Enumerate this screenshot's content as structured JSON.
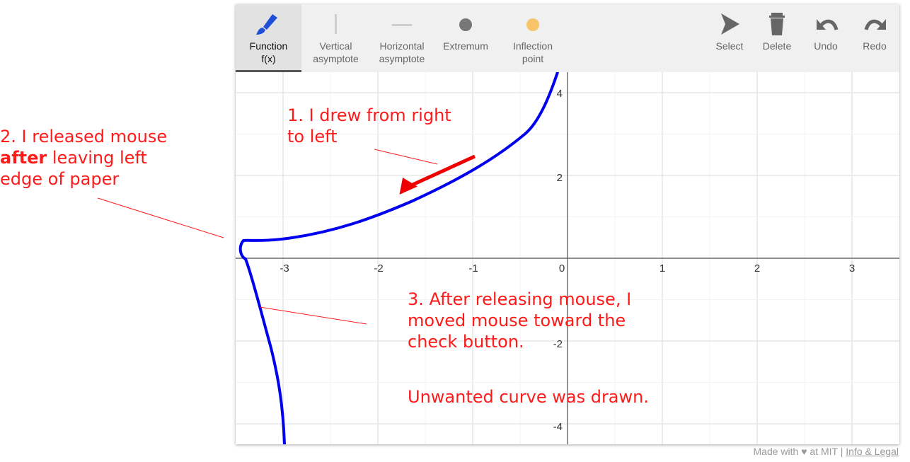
{
  "toolbar": {
    "tools": [
      {
        "label": "Function",
        "sublabel": "f(x)",
        "icon": "paintbrush-icon",
        "active": true
      },
      {
        "label": "Vertical",
        "sublabel": "asymptote",
        "icon": "vertical-line-icon"
      },
      {
        "label": "Horizontal",
        "sublabel": "asymptote",
        "icon": "horizontal-line-icon"
      },
      {
        "label": "Extremum",
        "sublabel": "",
        "icon": "dot-icon"
      },
      {
        "label": "Inflection",
        "sublabel": "point",
        "icon": "orange-dot-icon"
      },
      {
        "label": "Select",
        "sublabel": "",
        "icon": "cursor-arrow-icon"
      },
      {
        "label": "Delete",
        "sublabel": "",
        "icon": "trash-icon"
      },
      {
        "label": "Undo",
        "sublabel": "",
        "icon": "undo-icon"
      },
      {
        "label": "Redo",
        "sublabel": "",
        "icon": "redo-icon"
      }
    ]
  },
  "graph": {
    "x_ticks": [
      "-3",
      "-2",
      "-1",
      "0",
      "1",
      "2",
      "3"
    ],
    "y_ticks": [
      "4",
      "2",
      "-2",
      "-4"
    ],
    "curve_color": "#0000ee",
    "arrow_color": "#ff1a1a"
  },
  "annotations": {
    "note1": [
      "1. I drew from right",
      "to left"
    ],
    "note2_line1": "2. I released mouse",
    "note2_bold": "after",
    "note2_rest": " leaving left",
    "note2_line3": "edge of paper",
    "note3": [
      "3. After releasing mouse, I",
      "moved mouse toward the",
      "check button."
    ],
    "note4": "Unwanted curve was drawn."
  },
  "footer": {
    "made_with_prefix": "Made with",
    "made_with_suffix": "at MIT |",
    "info_link": "Info & Legal"
  },
  "colors": {
    "annotation": "#ff1a1a",
    "toolbar_bg": "#f0f0f0",
    "grid_major": "#e6e6e6",
    "grid_minor": "#f3f3f3"
  }
}
